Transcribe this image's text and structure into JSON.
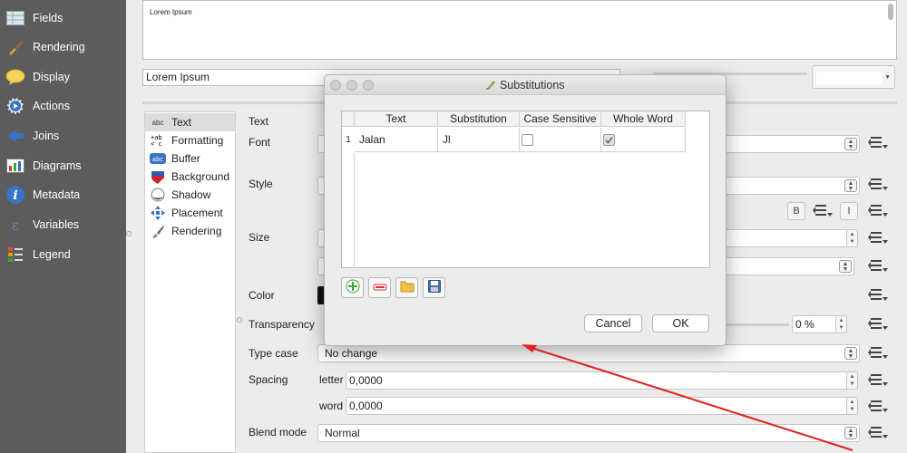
{
  "sidebar": {
    "items": [
      {
        "label": "Fields",
        "icon": "fields-table-icon"
      },
      {
        "label": "Rendering",
        "icon": "paint-brush-icon"
      },
      {
        "label": "Display",
        "icon": "speech-bubble-icon"
      },
      {
        "label": "Actions",
        "icon": "gear-play-icon"
      },
      {
        "label": "Joins",
        "icon": "join-arrow-icon"
      },
      {
        "label": "Diagrams",
        "icon": "chart-icon"
      },
      {
        "label": "Metadata",
        "icon": "info-icon"
      },
      {
        "label": "Variables",
        "icon": "variables-icon"
      },
      {
        "label": "Legend",
        "icon": "legend-icon"
      }
    ]
  },
  "top": {
    "textarea_text": "Lorem Ipsum",
    "expression_value": "Lorem Ipsum"
  },
  "label_tabs": {
    "items": [
      {
        "label": "Text",
        "icon": "abc"
      },
      {
        "label": "Formatting",
        "icon": "+ab c"
      },
      {
        "label": "Buffer",
        "icon": "abc"
      },
      {
        "label": "Background",
        "icon": "shield-icon"
      },
      {
        "label": "Shadow",
        "icon": "shadow-icon"
      },
      {
        "label": "Placement",
        "icon": "placement-icon"
      },
      {
        "label": "Rendering",
        "icon": "brush-icon"
      }
    ]
  },
  "form": {
    "section_label": "Text",
    "font_label": "Font",
    "style_label": "Style",
    "size_label": "Size",
    "color_label": "Color",
    "transparency_label": "Transparency",
    "transparency_value": "0 %",
    "type_case_label": "Type case",
    "type_case_value": "No change",
    "spacing_label": "Spacing",
    "letter_label": "letter",
    "letter_value": "0,0000",
    "word_label": "word",
    "word_value": "0,0000",
    "blend_mode_label": "Blend mode",
    "blend_mode_value": "Normal",
    "bold_label": "B",
    "italic_label": "I"
  },
  "dialog": {
    "title": "Substitutions",
    "columns": [
      "Text",
      "Substitution",
      "Case Sensitive",
      "Whole Word"
    ],
    "rows": [
      {
        "num": "1",
        "text": "Jalan",
        "substitution": "Jl",
        "case_sensitive": false,
        "whole_word": true
      }
    ],
    "cancel_label": "Cancel",
    "ok_label": "OK"
  },
  "colors": {
    "sidebar_bg": "#5c5c5c",
    "annotation_arrow": "#e02020"
  }
}
